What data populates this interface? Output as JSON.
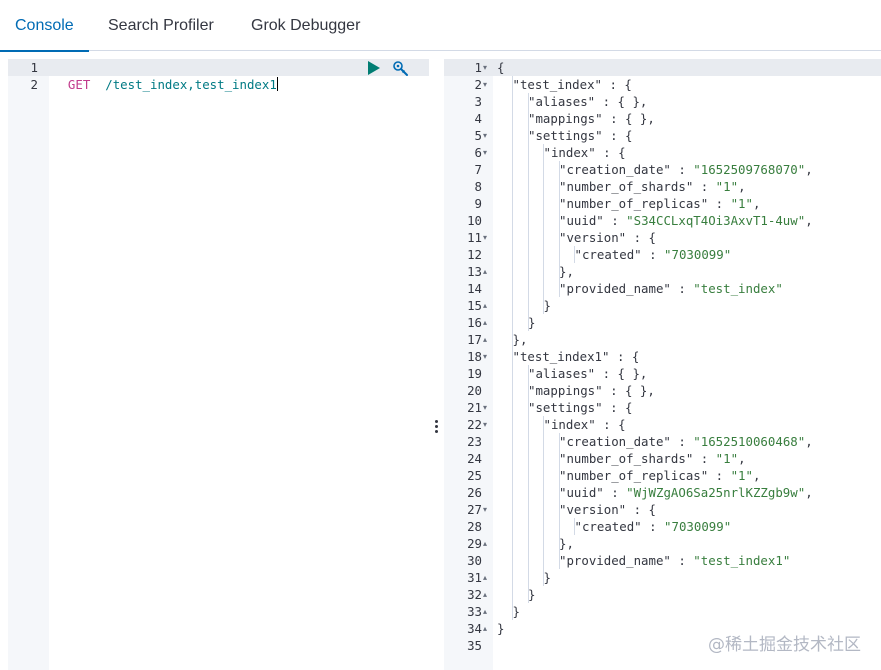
{
  "tabs": [
    {
      "label": "Console",
      "active": true
    },
    {
      "label": "Search Profiler",
      "active": false
    },
    {
      "label": "Grok Debugger",
      "active": false
    }
  ],
  "request_editor": {
    "line_numbers": [
      "1",
      "2"
    ],
    "method": "GET",
    "path": "/test_index,test_index1",
    "play_icon": "play-icon",
    "wrench_icon": "wrench-icon"
  },
  "response": {
    "lines": [
      {
        "n": "1",
        "indent": 0,
        "fold": "open",
        "parts": [
          [
            "pun",
            "{"
          ]
        ]
      },
      {
        "n": "2",
        "indent": 1,
        "fold": "open",
        "parts": [
          [
            "key",
            "\"test_index\""
          ],
          [
            "pun",
            " : {"
          ]
        ]
      },
      {
        "n": "3",
        "indent": 2,
        "fold": "",
        "parts": [
          [
            "key",
            "\"aliases\""
          ],
          [
            "pun",
            " : { },"
          ]
        ]
      },
      {
        "n": "4",
        "indent": 2,
        "fold": "",
        "parts": [
          [
            "key",
            "\"mappings\""
          ],
          [
            "pun",
            " : { },"
          ]
        ]
      },
      {
        "n": "5",
        "indent": 2,
        "fold": "open",
        "parts": [
          [
            "key",
            "\"settings\""
          ],
          [
            "pun",
            " : {"
          ]
        ]
      },
      {
        "n": "6",
        "indent": 3,
        "fold": "open",
        "parts": [
          [
            "key",
            "\"index\""
          ],
          [
            "pun",
            " : {"
          ]
        ]
      },
      {
        "n": "7",
        "indent": 4,
        "fold": "",
        "parts": [
          [
            "key",
            "\"creation_date\""
          ],
          [
            "pun",
            " : "
          ],
          [
            "str",
            "\"1652509768070\""
          ],
          [
            "pun",
            ","
          ]
        ]
      },
      {
        "n": "8",
        "indent": 4,
        "fold": "",
        "parts": [
          [
            "key",
            "\"number_of_shards\""
          ],
          [
            "pun",
            " : "
          ],
          [
            "str",
            "\"1\""
          ],
          [
            "pun",
            ","
          ]
        ]
      },
      {
        "n": "9",
        "indent": 4,
        "fold": "",
        "parts": [
          [
            "key",
            "\"number_of_replicas\""
          ],
          [
            "pun",
            " : "
          ],
          [
            "str",
            "\"1\""
          ],
          [
            "pun",
            ","
          ]
        ]
      },
      {
        "n": "10",
        "indent": 4,
        "fold": "",
        "parts": [
          [
            "key",
            "\"uuid\""
          ],
          [
            "pun",
            " : "
          ],
          [
            "str",
            "\"S34CCLxqT4Oi3AxvT1-4uw\""
          ],
          [
            "pun",
            ","
          ]
        ]
      },
      {
        "n": "11",
        "indent": 4,
        "fold": "open",
        "parts": [
          [
            "key",
            "\"version\""
          ],
          [
            "pun",
            " : {"
          ]
        ]
      },
      {
        "n": "12",
        "indent": 5,
        "fold": "",
        "parts": [
          [
            "key",
            "\"created\""
          ],
          [
            "pun",
            " : "
          ],
          [
            "str",
            "\"7030099\""
          ]
        ]
      },
      {
        "n": "13",
        "indent": 4,
        "fold": "close",
        "parts": [
          [
            "pun",
            "},"
          ]
        ]
      },
      {
        "n": "14",
        "indent": 4,
        "fold": "",
        "parts": [
          [
            "key",
            "\"provided_name\""
          ],
          [
            "pun",
            " : "
          ],
          [
            "str",
            "\"test_index\""
          ]
        ]
      },
      {
        "n": "15",
        "indent": 3,
        "fold": "close",
        "parts": [
          [
            "pun",
            "}"
          ]
        ]
      },
      {
        "n": "16",
        "indent": 2,
        "fold": "close",
        "parts": [
          [
            "pun",
            "}"
          ]
        ]
      },
      {
        "n": "17",
        "indent": 1,
        "fold": "close",
        "parts": [
          [
            "pun",
            "},"
          ]
        ]
      },
      {
        "n": "18",
        "indent": 1,
        "fold": "open",
        "parts": [
          [
            "key",
            "\"test_index1\""
          ],
          [
            "pun",
            " : {"
          ]
        ]
      },
      {
        "n": "19",
        "indent": 2,
        "fold": "",
        "parts": [
          [
            "key",
            "\"aliases\""
          ],
          [
            "pun",
            " : { },"
          ]
        ]
      },
      {
        "n": "20",
        "indent": 2,
        "fold": "",
        "parts": [
          [
            "key",
            "\"mappings\""
          ],
          [
            "pun",
            " : { },"
          ]
        ]
      },
      {
        "n": "21",
        "indent": 2,
        "fold": "open",
        "parts": [
          [
            "key",
            "\"settings\""
          ],
          [
            "pun",
            " : {"
          ]
        ]
      },
      {
        "n": "22",
        "indent": 3,
        "fold": "open",
        "parts": [
          [
            "key",
            "\"index\""
          ],
          [
            "pun",
            " : {"
          ]
        ]
      },
      {
        "n": "23",
        "indent": 4,
        "fold": "",
        "parts": [
          [
            "key",
            "\"creation_date\""
          ],
          [
            "pun",
            " : "
          ],
          [
            "str",
            "\"1652510060468\""
          ],
          [
            "pun",
            ","
          ]
        ]
      },
      {
        "n": "24",
        "indent": 4,
        "fold": "",
        "parts": [
          [
            "key",
            "\"number_of_shards\""
          ],
          [
            "pun",
            " : "
          ],
          [
            "str",
            "\"1\""
          ],
          [
            "pun",
            ","
          ]
        ]
      },
      {
        "n": "25",
        "indent": 4,
        "fold": "",
        "parts": [
          [
            "key",
            "\"number_of_replicas\""
          ],
          [
            "pun",
            " : "
          ],
          [
            "str",
            "\"1\""
          ],
          [
            "pun",
            ","
          ]
        ]
      },
      {
        "n": "26",
        "indent": 4,
        "fold": "",
        "parts": [
          [
            "key",
            "\"uuid\""
          ],
          [
            "pun",
            " : "
          ],
          [
            "str",
            "\"WjWZgAO6Sa25nrlKZZgb9w\""
          ],
          [
            "pun",
            ","
          ]
        ]
      },
      {
        "n": "27",
        "indent": 4,
        "fold": "open",
        "parts": [
          [
            "key",
            "\"version\""
          ],
          [
            "pun",
            " : {"
          ]
        ]
      },
      {
        "n": "28",
        "indent": 5,
        "fold": "",
        "parts": [
          [
            "key",
            "\"created\""
          ],
          [
            "pun",
            " : "
          ],
          [
            "str",
            "\"7030099\""
          ]
        ]
      },
      {
        "n": "29",
        "indent": 4,
        "fold": "close",
        "parts": [
          [
            "pun",
            "},"
          ]
        ]
      },
      {
        "n": "30",
        "indent": 4,
        "fold": "",
        "parts": [
          [
            "key",
            "\"provided_name\""
          ],
          [
            "pun",
            " : "
          ],
          [
            "str",
            "\"test_index1\""
          ]
        ]
      },
      {
        "n": "31",
        "indent": 3,
        "fold": "close",
        "parts": [
          [
            "pun",
            "}"
          ]
        ]
      },
      {
        "n": "32",
        "indent": 2,
        "fold": "close",
        "parts": [
          [
            "pun",
            "}"
          ]
        ]
      },
      {
        "n": "33",
        "indent": 1,
        "fold": "close",
        "parts": [
          [
            "pun",
            "}"
          ]
        ]
      },
      {
        "n": "34",
        "indent": 0,
        "fold": "close",
        "parts": [
          [
            "pun",
            "}"
          ]
        ]
      },
      {
        "n": "35",
        "indent": 0,
        "fold": "",
        "parts": []
      }
    ]
  },
  "watermark": "@稀土掘金技术社区",
  "colors": {
    "accent": "#006bb4",
    "method": "#c23c8c",
    "url": "#007a84",
    "string": "#387e3e",
    "gutter": "#f5f7fa",
    "active_line": "#e8ebf0"
  }
}
